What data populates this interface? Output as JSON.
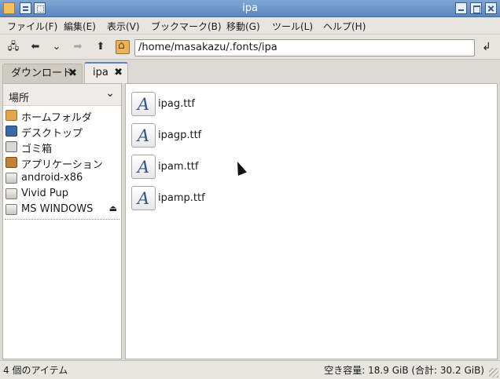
{
  "window": {
    "title": "ipa"
  },
  "menu": [
    "ファイル(F)",
    "編集(E)",
    "表示(V)",
    "ブックマーク(B)",
    "移動(G)",
    "ツール(L)",
    "ヘルプ(H)"
  ],
  "toolbar": {
    "location": "/home/masakazu/.fonts/ipa",
    "icons": [
      "side-pane-icon",
      "back-arrow-icon",
      "history-chevron-icon",
      "forward-arrow-icon",
      "up-arrow-icon",
      "home-icon",
      "go-icon"
    ]
  },
  "tabs": [
    {
      "label": "ダウンロード",
      "active": false
    },
    {
      "label": "ipa",
      "active": true
    }
  ],
  "side_pane": {
    "header": "場所",
    "places": [
      "ホームフォルダ",
      "デスクトップ",
      "ゴミ箱",
      "アプリケーション"
    ],
    "volumes": [
      "android-x86",
      "Vivid Pup",
      "MS WINDOWS"
    ]
  },
  "files": [
    "ipag.ttf",
    "ipagp.ttf",
    "ipam.ttf",
    "ipamp.ttf"
  ],
  "status": {
    "item_count": "4 個のアイテム",
    "free_space": "空き容量: 18.9 GiB (合計: 30.2 GiB)"
  },
  "colors": {
    "titlebar": "#5b86bf",
    "font_icon_letter": "#34558a"
  }
}
